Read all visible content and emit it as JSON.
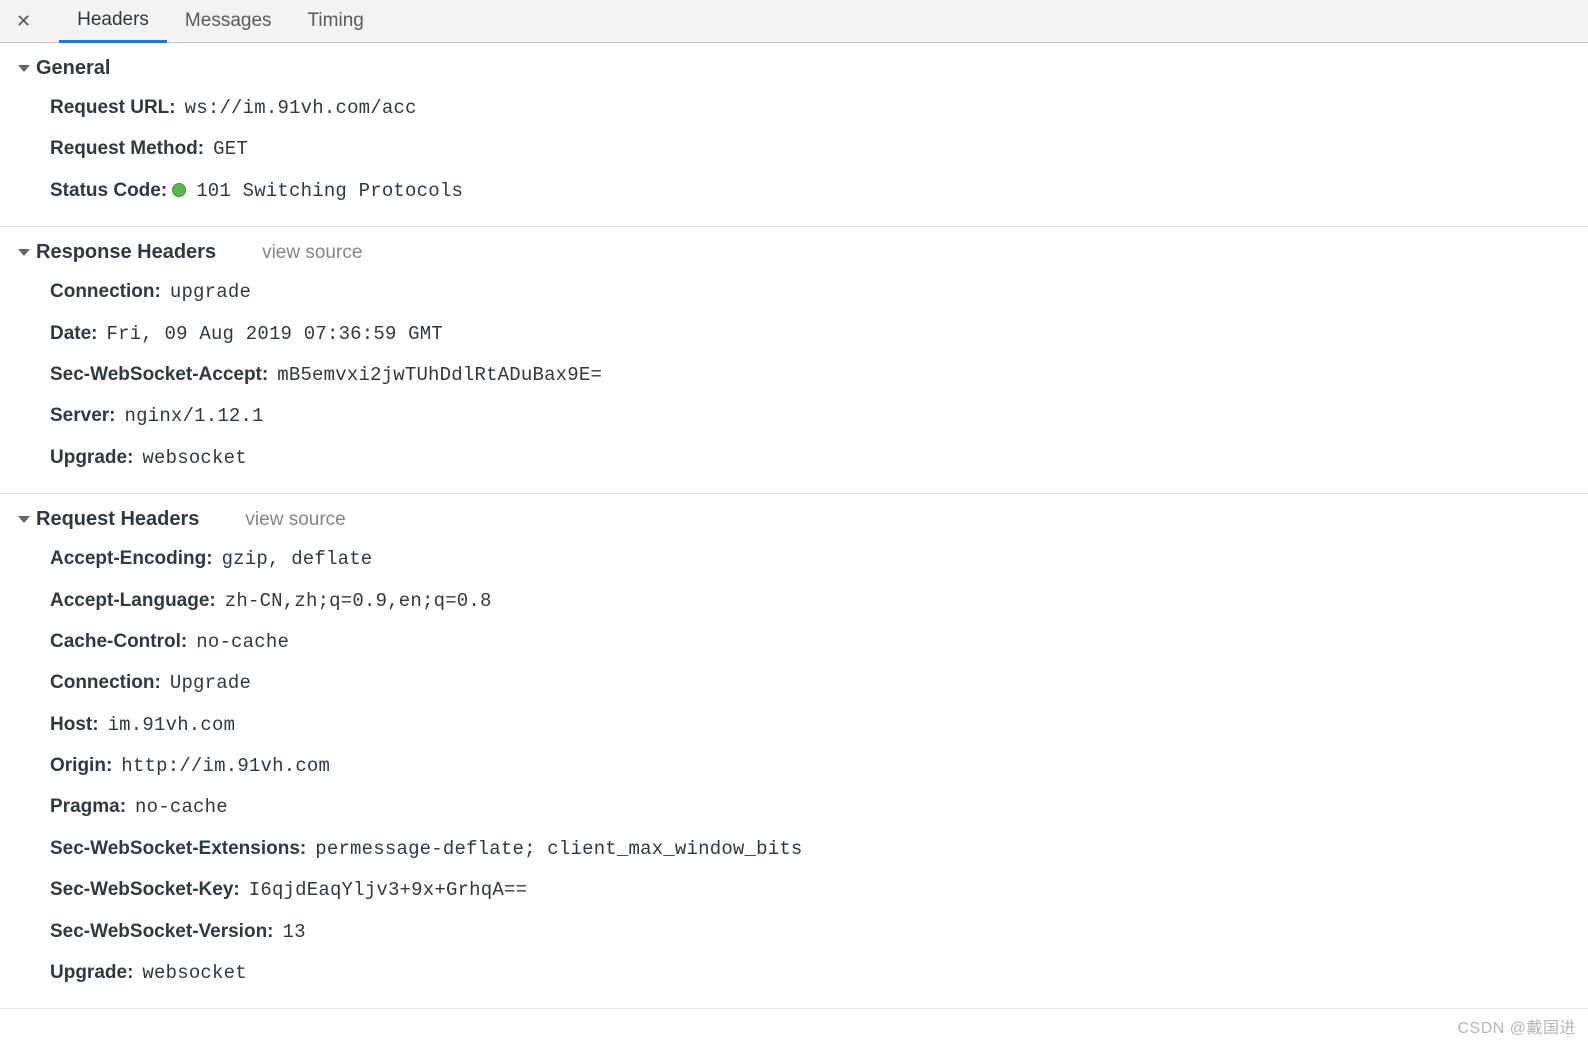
{
  "tabs": {
    "headers": "Headers",
    "messages": "Messages",
    "timing": "Timing"
  },
  "sections": {
    "general": {
      "title": "General",
      "request_url_label": "Request URL:",
      "request_url_value": "ws://im.91vh.com/acc",
      "request_method_label": "Request Method:",
      "request_method_value": "GET",
      "status_code_label": "Status Code:",
      "status_code_value": "101 Switching Protocols"
    },
    "response": {
      "title": "Response Headers",
      "view_source": "view source",
      "rows": {
        "connection_k": "Connection:",
        "connection_v": "upgrade",
        "date_k": "Date:",
        "date_v": "Fri, 09 Aug 2019 07:36:59 GMT",
        "swa_k": "Sec-WebSocket-Accept:",
        "swa_v": "mB5emvxi2jwTUhDdlRtADuBax9E=",
        "server_k": "Server:",
        "server_v": "nginx/1.12.1",
        "upgrade_k": "Upgrade:",
        "upgrade_v": "websocket"
      }
    },
    "request": {
      "title": "Request Headers",
      "view_source": "view source",
      "rows": {
        "ae_k": "Accept-Encoding:",
        "ae_v": "gzip, deflate",
        "al_k": "Accept-Language:",
        "al_v": "zh-CN,zh;q=0.9,en;q=0.8",
        "cc_k": "Cache-Control:",
        "cc_v": "no-cache",
        "conn_k": "Connection:",
        "conn_v": "Upgrade",
        "host_k": "Host:",
        "host_v": "im.91vh.com",
        "origin_k": "Origin:",
        "origin_v": "http://im.91vh.com",
        "pragma_k": "Pragma:",
        "pragma_v": "no-cache",
        "swe_k": "Sec-WebSocket-Extensions:",
        "swe_v": "permessage-deflate; client_max_window_bits",
        "swk_k": "Sec-WebSocket-Key:",
        "swk_v": "I6qjdEaqYljv3+9x+GrhqA==",
        "swv_k": "Sec-WebSocket-Version:",
        "swv_v": "13",
        "upg_k": "Upgrade:",
        "upg_v": "websocket"
      }
    }
  },
  "watermark": "CSDN @戴国进"
}
